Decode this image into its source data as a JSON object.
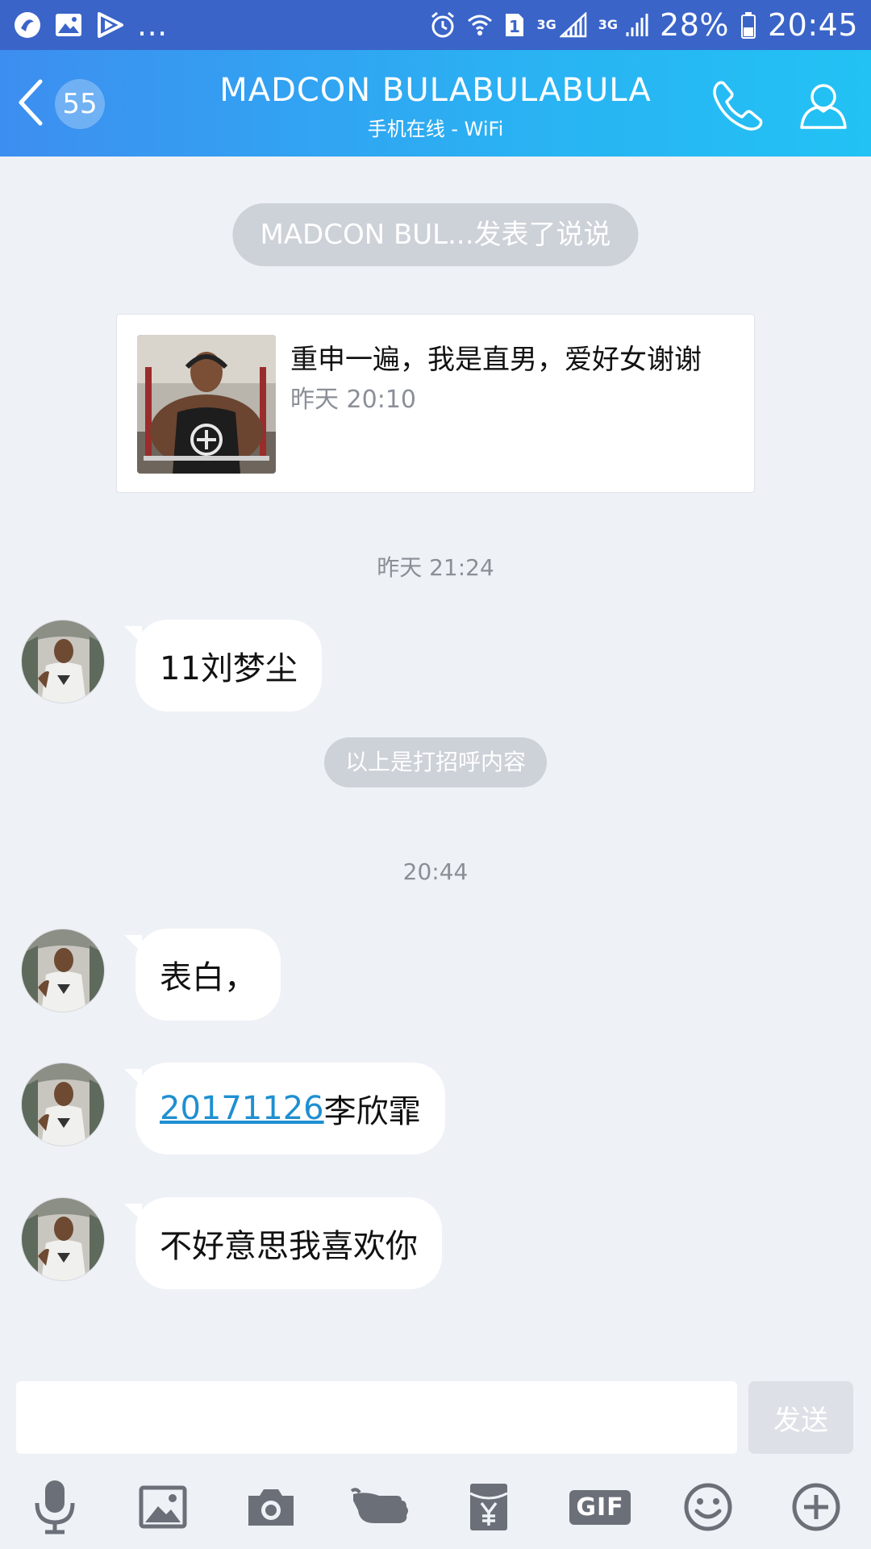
{
  "status_bar": {
    "battery_percent": "28%",
    "time": "20:45",
    "network_1": "3G",
    "network_2": "3G",
    "sim_slot": "1",
    "more": "..."
  },
  "header": {
    "unread_count": "55",
    "title": "MADCON BULABULABULA",
    "subtitle": "手机在线 - WiFi"
  },
  "chat": {
    "system_notice": "MADCON BUL...发表了说说",
    "post": {
      "text": "重申一遍，我是直男，爱好女谢谢",
      "time": "昨天 20:10"
    },
    "timestamp_1": "昨天 21:24",
    "message_1": "11刘梦尘",
    "greeting_notice": "以上是打招呼内容",
    "timestamp_2": "20:44",
    "message_2": "表白，",
    "message_3_link": "20171126",
    "message_3_text": "李欣霏",
    "message_4": "不好意思我喜欢你"
  },
  "input": {
    "value": "",
    "send_label": "发送"
  },
  "toolbar": {
    "gif_label": "GIF",
    "icons": [
      "microphone-icon",
      "image-icon",
      "camera-icon",
      "poke-icon",
      "red-packet-icon",
      "gif-icon",
      "emoji-icon",
      "plus-icon"
    ]
  },
  "colors": {
    "header_start": "#3d8ef0",
    "header_end": "#22c2f4",
    "background": "#eef1f6",
    "link": "#1f8fd1"
  }
}
